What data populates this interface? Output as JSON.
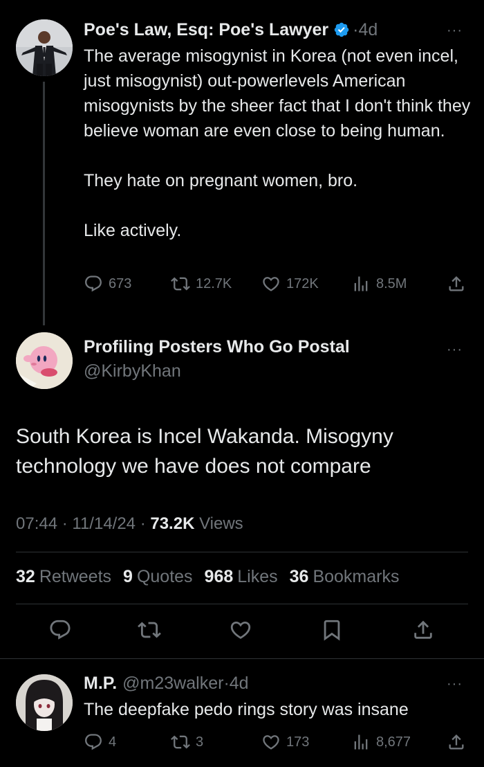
{
  "tweet1": {
    "author_name": "Poe's Law, Esq: Poe's Lawyer",
    "dot": "·",
    "time": "4d",
    "more": "···",
    "paragraphs": [
      "The average misogynist in Korea (not even incel, just misogynist) out-powerlevels American misogynists by the sheer fact that I don't think they believe woman are even close to being human.",
      "They hate on pregnant women, bro.",
      "Like actively."
    ],
    "replies": "673",
    "retweets": "12.7K",
    "likes": "172K",
    "views": "8.5M"
  },
  "tweet2": {
    "author_name": "Profiling Posters Who Go Postal",
    "handle": "@KirbyKhan",
    "more": "···",
    "text": "South Korea is Incel Wakanda. Misogyny technology we have does not compare",
    "time": "07:44",
    "sep1": " · ",
    "date": "11/14/24",
    "sep2": " · ",
    "views_count": "73.2K",
    "views_label": "Views",
    "stats": [
      {
        "count": "32",
        "label": "Retweets"
      },
      {
        "count": "9",
        "label": "Quotes"
      },
      {
        "count": "968",
        "label": "Likes"
      },
      {
        "count": "36",
        "label": "Bookmarks"
      }
    ]
  },
  "tweet3": {
    "author_name": "M.P.",
    "handle": "@m23walker",
    "dot": "·",
    "time": "4d",
    "more": "···",
    "text": "The deepfake pedo rings story was insane",
    "replies": "4",
    "retweets": "3",
    "likes": "173",
    "views": "8,677"
  },
  "colors": {
    "background": "#000000",
    "text": "#e7e9ea",
    "secondary": "#71767b",
    "verified": "#1d9bf0",
    "divider": "#2f3336"
  },
  "icons": [
    "reply-icon",
    "retweet-icon",
    "like-icon",
    "views-icon",
    "share-icon",
    "bookmark-icon",
    "verified-badge-icon",
    "more-icon"
  ]
}
